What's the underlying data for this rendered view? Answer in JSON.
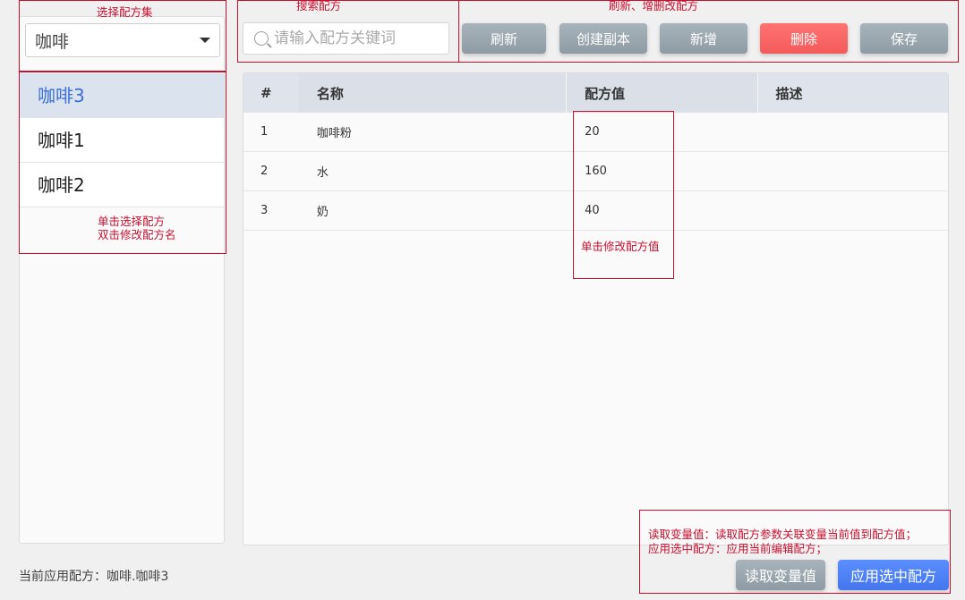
{
  "recipe_set_select": {
    "value": "咖啡"
  },
  "recipes": [
    {
      "name": "咖啡3",
      "selected": true
    },
    {
      "name": "咖啡1",
      "selected": false
    },
    {
      "name": "咖啡2",
      "selected": false
    }
  ],
  "search": {
    "placeholder": "请输入配方关键词"
  },
  "toolbar": {
    "refresh": "刷新",
    "copy": "创建副本",
    "add": "新增",
    "delete": "删除",
    "save": "保存"
  },
  "table": {
    "headers": [
      "#",
      "名称",
      "配方值",
      "描述"
    ],
    "rows": [
      {
        "index": "1",
        "name": "咖啡粉",
        "value": "20",
        "desc": ""
      },
      {
        "index": "2",
        "name": "水",
        "value": "160",
        "desc": ""
      },
      {
        "index": "3",
        "name": "奶",
        "value": "40",
        "desc": ""
      }
    ]
  },
  "actions": {
    "read_vars": "读取变量值",
    "apply": "应用选中配方"
  },
  "status": {
    "text": "当前应用配方：咖啡.咖啡3"
  },
  "annotations": {
    "select_set": "选择配方集",
    "search": "搜索配方",
    "crud": "刷新、增删改配方",
    "list_line1": "单击选择配方",
    "list_line2": "双击修改配方名",
    "edit_value": "单击修改配方值",
    "bottom_line1": "读取变量值：读取配方参数关联变量当前值到配方值；",
    "bottom_line2": "应用选中配方：应用当前编辑配方；"
  },
  "colors": {
    "accent": "#3a6fd8",
    "danger": "#f45a5a",
    "annotation": "#c8102e"
  }
}
